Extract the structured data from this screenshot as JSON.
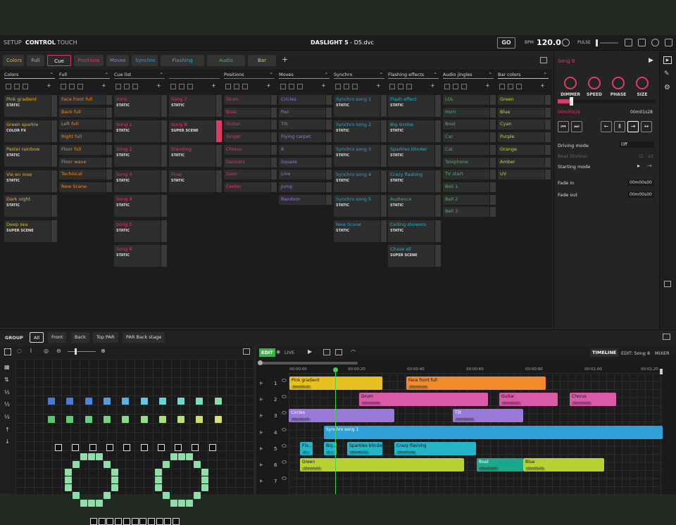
{
  "topbar": {
    "menus": [
      "SETUP",
      "CONTROL",
      "TOUCH"
    ],
    "title": "DASLIGHT 5",
    "file": "- D5.dvc",
    "go": "GO",
    "bpm_label": "BPM",
    "bpm_value": "120.0",
    "pulse_label": "PULSE"
  },
  "tabs": [
    "Colors",
    "Full",
    "Cue list",
    "Positions",
    "Moves",
    "Synchro",
    "Flashing effects",
    "Audio jingles",
    "Bar colors",
    "+"
  ],
  "tab_colors": [
    "#e8b820",
    "#e8b820",
    "#e03a64",
    "#e03a64",
    "#9a7ad8",
    "#2fa0d8",
    "#23b5c8",
    "#4bb85a",
    "#c8d830"
  ],
  "columns": [
    {
      "title": "Colors",
      "color": "#e8b820",
      "cues": [
        {
          "name": "Pink gradient",
          "sub": "STATIC"
        },
        {
          "name": "Green sparkle",
          "sub": "COLOR FX"
        },
        {
          "name": "Pastel rainbow",
          "sub": "STATIC"
        },
        {
          "name": "Vie en rose",
          "sub": "STATIC"
        },
        {
          "name": "Dark night",
          "sub": "STATIC"
        },
        {
          "name": "Deep sea",
          "sub": "SUPER SCENE"
        }
      ]
    },
    {
      "title": "Full",
      "color": "#f08a2a",
      "cues": [
        {
          "name": "Face front full",
          "sub": ""
        },
        {
          "name": "Back full",
          "sub": ""
        },
        {
          "name": "Left full",
          "sub": ""
        },
        {
          "name": "Right full",
          "sub": ""
        },
        {
          "name": "Floor full",
          "sub": ""
        },
        {
          "name": "Floor wave",
          "sub": ""
        },
        {
          "name": "Technical",
          "sub": ""
        },
        {
          "name": "New Scene",
          "sub": ""
        }
      ]
    },
    {
      "title": "Cue list",
      "color": "#e03a64",
      "cues": [
        {
          "name": "Intro",
          "sub": "STATIC"
        },
        {
          "name": "Song 1",
          "sub": "STATIC"
        },
        {
          "name": "Song 2",
          "sub": "STATIC"
        },
        {
          "name": "Song 3",
          "sub": "STATIC"
        },
        {
          "name": "Song 4",
          "sub": "STATIC"
        },
        {
          "name": "Song 5",
          "sub": "STATIC"
        },
        {
          "name": "Song 6",
          "sub": "STATIC"
        }
      ]
    },
    {
      "title": "",
      "color": "#e03a64",
      "cues": [
        {
          "name": "Song 7",
          "sub": "STATIC"
        },
        {
          "name": "Song 8",
          "sub": "SUPER SCENE"
        },
        {
          "name": "Standing",
          "sub": "STATIC"
        },
        {
          "name": "Final",
          "sub": "STATIC"
        }
      ]
    },
    {
      "title": "Positions",
      "color": "#e03a64",
      "cues": [
        {
          "name": "Drum",
          "sub": ""
        },
        {
          "name": "Bass",
          "sub": ""
        },
        {
          "name": "Guitar",
          "sub": ""
        },
        {
          "name": "Singer",
          "sub": ""
        },
        {
          "name": "Chorus",
          "sub": ""
        },
        {
          "name": "Dancers",
          "sub": ""
        },
        {
          "name": "Saxo",
          "sub": ""
        },
        {
          "name": "Center",
          "sub": ""
        }
      ]
    },
    {
      "title": "Moves",
      "color": "#9a7ad8",
      "cues": [
        {
          "name": "Circles",
          "sub": ""
        },
        {
          "name": "Pan",
          "sub": ""
        },
        {
          "name": "Tilt",
          "sub": ""
        },
        {
          "name": "Flying carpet",
          "sub": ""
        },
        {
          "name": "8",
          "sub": ""
        },
        {
          "name": "Square",
          "sub": ""
        },
        {
          "name": "Line",
          "sub": ""
        },
        {
          "name": "Jump",
          "sub": ""
        },
        {
          "name": "Random",
          "sub": ""
        }
      ]
    },
    {
      "title": "Synchro",
      "color": "#2fa0d8",
      "cues": [
        {
          "name": "Synchro song 1",
          "sub": "STATIC"
        },
        {
          "name": "Synchro song 2",
          "sub": "STATIC"
        },
        {
          "name": "Synchro song 3",
          "sub": "STATIC"
        },
        {
          "name": "Synchro song 4",
          "sub": "STATIC"
        },
        {
          "name": "Synchro song 5",
          "sub": "STATIC"
        },
        {
          "name": "New Scene",
          "sub": "STATIC"
        }
      ]
    },
    {
      "title": "Flashing effects",
      "color": "#23b5c8",
      "cues": [
        {
          "name": "Flash effect",
          "sub": "STATIC"
        },
        {
          "name": "Big strobe",
          "sub": "STATIC"
        },
        {
          "name": "Sparkles blinder",
          "sub": "STATIC"
        },
        {
          "name": "Crazy flashing",
          "sub": "STATIC"
        },
        {
          "name": "Audience",
          "sub": "STATIC"
        },
        {
          "name": "Ceiling showers",
          "sub": "STATIC"
        },
        {
          "name": "Chase all",
          "sub": "SUPER SCENE"
        }
      ]
    },
    {
      "title": "Audio jingles",
      "color": "#4bb85a",
      "cues": [
        {
          "name": "LOL",
          "sub": ""
        },
        {
          "name": "Horn",
          "sub": ""
        },
        {
          "name": "Boat",
          "sub": ""
        },
        {
          "name": "Car",
          "sub": ""
        },
        {
          "name": "Cat",
          "sub": ""
        },
        {
          "name": "Telephone",
          "sub": ""
        },
        {
          "name": "TV start",
          "sub": ""
        },
        {
          "name": "Bell 1",
          "sub": ""
        },
        {
          "name": "Bell 2",
          "sub": ""
        },
        {
          "name": "Bell 3",
          "sub": ""
        }
      ]
    },
    {
      "title": "Bar colors",
      "color": "#c8d830",
      "cues": [
        {
          "name": "Green",
          "sub": ""
        },
        {
          "name": "Blue",
          "sub": ""
        },
        {
          "name": "Cyan",
          "sub": ""
        },
        {
          "name": "Purple",
          "sub": ""
        },
        {
          "name": "Orange",
          "sub": ""
        },
        {
          "name": "Amber",
          "sub": ""
        },
        {
          "name": "UV",
          "sub": ""
        }
      ]
    }
  ],
  "right_panel": {
    "song": "Song 8",
    "knobs": [
      "DIMMER",
      "SPEED",
      "PHASE",
      "SIZE"
    ],
    "time_current": "00m00s16",
    "time_total": "00m01s28",
    "driving_mode_label": "Driving mode",
    "driving_mode_value": "Off",
    "beat_division_label": "Beat Division",
    "beat_division_opts": [
      "/2",
      "x2"
    ],
    "starting_mode_label": "Starting mode",
    "fade_in_label": "Fade in",
    "fade_in_value": "00m00s00",
    "fade_out_label": "Fade out",
    "fade_out_value": "00m00s00"
  },
  "groupbar": {
    "label": "GROUP",
    "tabs": [
      "All",
      "Front",
      "Back",
      "Top PAR",
      "PAR Back stage"
    ]
  },
  "timeline_header": {
    "edit": "EDIT",
    "live": "LIVE",
    "timeline": "TIMELINE",
    "edit_song": "EDIT: Song 8",
    "mixer": "MIXER",
    "ticks": [
      "00:00:00",
      "00:00:20",
      "00:00:40",
      "00:00:60",
      "00:00:80",
      "00:01:00",
      "00:01:20"
    ]
  },
  "tracks": [
    "1",
    "2",
    "3",
    "4",
    "5",
    "6",
    "7"
  ],
  "clips": [
    {
      "track": 0,
      "name": "Pink gradient",
      "time": "00m00s32",
      "color": "#e8c020"
    },
    {
      "track": 0,
      "name": "Face front full",
      "time": "00m00s44",
      "color": "#f08a2a"
    },
    {
      "track": 1,
      "name": "Drum",
      "time": "00m00s44",
      "color": "#d85aa8"
    },
    {
      "track": 1,
      "name": "Guitar",
      "time": "00m00s20",
      "color": "#d85aa8"
    },
    {
      "track": 1,
      "name": "Chorus",
      "time": "00m00s28",
      "color": "#d85aa8"
    },
    {
      "track": 2,
      "name": "Circles",
      "time": "00m00s44",
      "color": "#9a7ad8"
    },
    {
      "track": 2,
      "name": "Tilt",
      "time": "00m00s24",
      "color": "#9a7ad8"
    },
    {
      "track": 3,
      "name": "Synchro song 1",
      "time": "",
      "color": "#2fa0d8"
    },
    {
      "track": 4,
      "name": "Fla...",
      "time": "0...",
      "color": "#23b5c8"
    },
    {
      "track": 4,
      "name": "Big...",
      "time": "0...",
      "color": "#23b5c8"
    },
    {
      "track": 4,
      "name": "Sparkles blinder",
      "time": "00m00s12",
      "color": "#23b5c8"
    },
    {
      "track": 4,
      "name": "Crazy flashing",
      "time": "00m00s28",
      "color": "#23b5c8"
    },
    {
      "track": 5,
      "name": "Green",
      "time": "00m00s56",
      "color": "#b8d030"
    },
    {
      "track": 5,
      "name": "Boat",
      "time": "00m00s08",
      "color": "#1aa88a"
    },
    {
      "track": 5,
      "name": "Blue",
      "time": "00m00s28",
      "color": "#b8d030"
    }
  ]
}
